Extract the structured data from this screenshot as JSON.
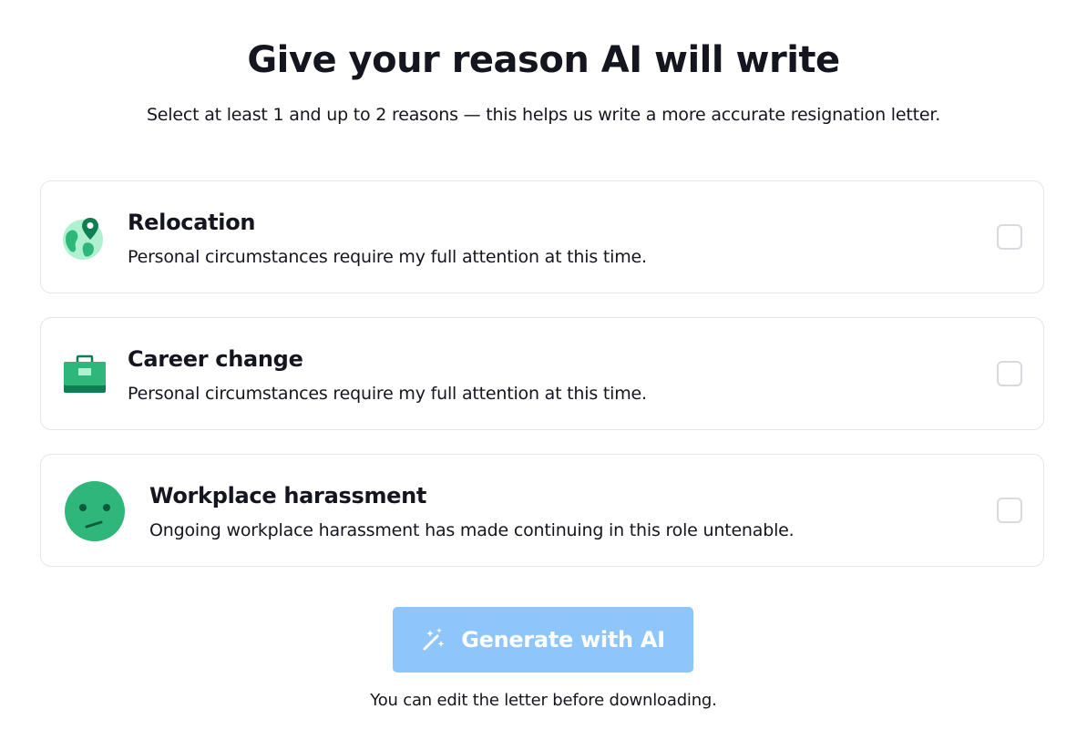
{
  "header": {
    "title": "Give your reason AI will write",
    "subtitle": "Select at least 1 and up to 2 reasons — this helps us write a more accurate resignation letter."
  },
  "reasons": [
    {
      "label": "Relocation",
      "description": "Personal circumstances require my full attention at this time.",
      "icon": "globe-location-icon",
      "checked": false
    },
    {
      "label": "Career change",
      "description": "Personal circumstances require my full attention at this time.",
      "icon": "briefcase-icon",
      "checked": false
    },
    {
      "label": "Workplace harassment",
      "description": "Ongoing workplace harassment has made continuing in this role untenable.",
      "icon": "uneasy-face-icon",
      "checked": false
    }
  ],
  "generate_button": {
    "label": "Generate with AI",
    "icon": "magic-wand-icon",
    "disabled": true
  },
  "footer_note": "You can edit the letter before downloading.",
  "colors": {
    "accent_green": "#2fb67a",
    "button_disabled_bg": "#8ec5fb",
    "text": "#15151f",
    "card_border": "#e3e5e8"
  }
}
